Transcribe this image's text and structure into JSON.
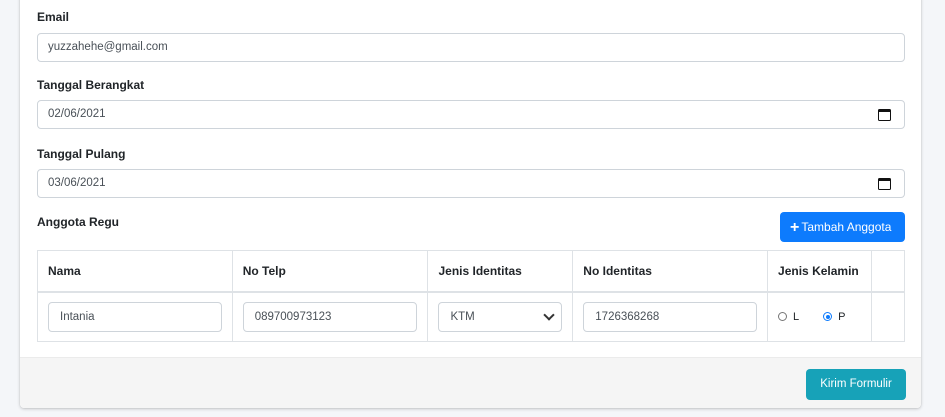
{
  "form": {
    "email": {
      "label": "Email",
      "value": "yuzzahehe@gmail.com"
    },
    "depart": {
      "label": "Tanggal Berangkat",
      "value": "02/06/2021"
    },
    "return": {
      "label": "Tanggal Pulang",
      "value": "03/06/2021"
    },
    "members": {
      "label": "Anggota Regu",
      "add_button": "Tambah Anggota",
      "columns": [
        "Nama",
        "No Telp",
        "Jenis Identitas",
        "No Identitas",
        "Jenis Kelamin",
        ""
      ],
      "rows": [
        {
          "name": "Intania",
          "phone": "089700973123",
          "id_type": "KTM",
          "id_number": "1726368268",
          "gender_options": [
            "L",
            "P"
          ],
          "gender_selected": "P"
        }
      ]
    },
    "submit": "Kirim Formulir"
  },
  "colors": {
    "primary": "#0d7bfd",
    "info": "#17a2b8",
    "background": "#f4f6f9"
  }
}
